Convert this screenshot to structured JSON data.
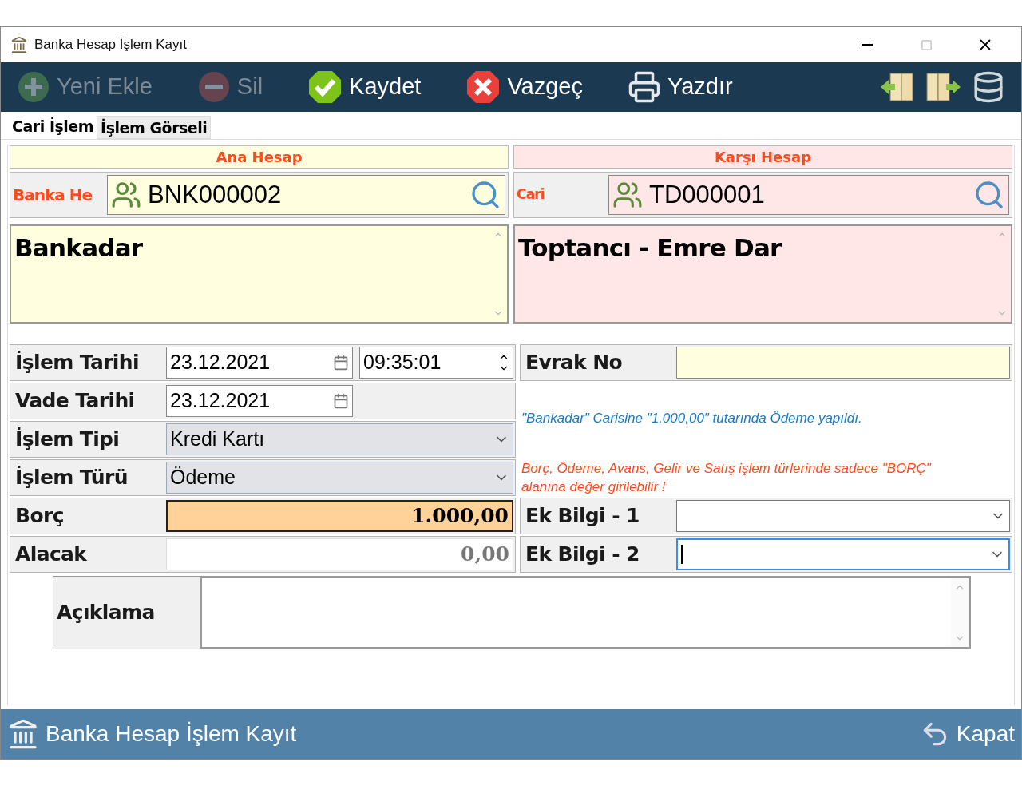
{
  "window": {
    "title": "Banka Hesap İşlem Kayıt"
  },
  "toolbar": {
    "buttons": [
      {
        "kind": "add",
        "label": "Yeni Ekle",
        "disabled": true
      },
      {
        "kind": "delete",
        "label": "Sil",
        "disabled": true
      },
      {
        "kind": "save",
        "label": "Kaydet",
        "disabled": false
      },
      {
        "kind": "cancel",
        "label": "Vazgeç",
        "disabled": false
      },
      {
        "kind": "print",
        "label": "Yazdır",
        "disabled": false
      }
    ]
  },
  "tabs": [
    {
      "label": "Cari İşlem",
      "selected": true
    },
    {
      "label": "İşlem Görseli",
      "selected": false
    }
  ],
  "accounts": [
    {
      "kind": "main",
      "header": "Ana Hesap",
      "label": "Banka He",
      "code": "BNK000002",
      "name": "Bankadar"
    },
    {
      "kind": "counter",
      "header": "Karşı Hesap",
      "label": "Cari",
      "code": "TD000001",
      "name": "Toptancı - Emre Dar"
    }
  ],
  "islem_tarihi": {
    "label": "İşlem Tarihi",
    "date": "23.12.2021",
    "time": "09:35:01"
  },
  "vade_tarihi": {
    "label": "Vade Tarihi",
    "date": "23.12.2021"
  },
  "islem_tipi": {
    "label": "İşlem Tipi",
    "value": "Kredi Kartı"
  },
  "islem_turu": {
    "label": "İşlem Türü",
    "value": "Ödeme"
  },
  "borc": {
    "label": "Borç",
    "value": "1.000,00",
    "highlighted": true
  },
  "alacak": {
    "label": "Alacak",
    "value": "0,00",
    "highlighted": false
  },
  "evrak_no": {
    "label": "Evrak No"
  },
  "info_message": "\"Bankadar\" Carisine \"1.000,00\" tutarında Ödeme yapıldı.",
  "warning_message": "Borç, Ödeme, Avans, Gelir ve Satış işlem türlerinde sadece \"BORÇ\" alanına değer girilebilir !",
  "ek_bilgi": [
    {
      "label": "Ek Bilgi - 1",
      "focused": false
    },
    {
      "label": "Ek Bilgi - 2",
      "focused": true
    }
  ],
  "aciklama": {
    "label": "Açıklama"
  },
  "footer": {
    "title": "Banka Hesap İşlem Kayıt",
    "close_label": "Kapat"
  }
}
